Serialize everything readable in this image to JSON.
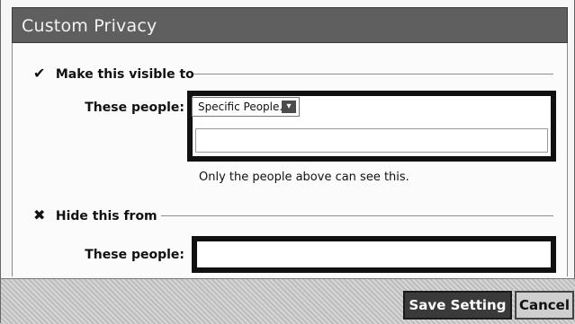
{
  "dialog": {
    "title": "Custom Privacy",
    "visible_section": {
      "icon": "checkmark-icon",
      "heading": "Make this visible to",
      "people_label": "These people:",
      "select_value": "Specific People...",
      "hint": "Only the people above can see this."
    },
    "hide_section": {
      "icon": "x-icon",
      "heading": "Hide this from",
      "people_label": "These people:"
    },
    "buttons": {
      "save": "Save Setting",
      "cancel": "Cancel"
    }
  }
}
